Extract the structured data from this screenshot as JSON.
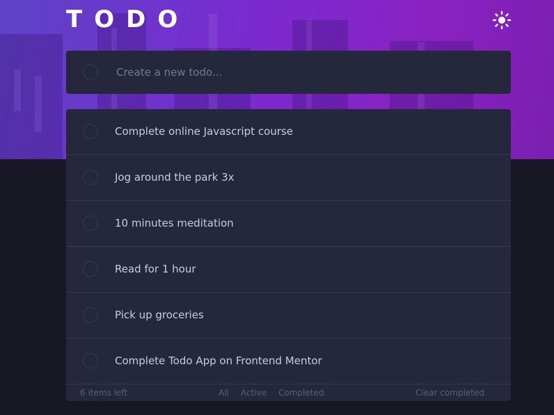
{
  "app": {
    "title": "TODO"
  },
  "theme_toggle": {
    "icon": "sun-icon"
  },
  "new_todo": {
    "placeholder": "Create a new todo..."
  },
  "todos": [
    {
      "text": "Complete online Javascript course",
      "completed": false
    },
    {
      "text": "Jog around the park 3x",
      "completed": false
    },
    {
      "text": "10 minutes meditation",
      "completed": false
    },
    {
      "text": "Read for 1 hour",
      "completed": false
    },
    {
      "text": "Pick up groceries",
      "completed": false
    },
    {
      "text": "Complete Todo App on Frontend Mentor",
      "completed": false
    }
  ],
  "footer": {
    "items_left": "6 items left",
    "filters": [
      "All",
      "Active",
      "Completed"
    ],
    "clear_completed": "Clear completed"
  },
  "colors": {
    "background": "#171823",
    "card": "#25273d",
    "text": "#c8cbe7",
    "muted": "#5b5e7e",
    "divider": "#393a4b",
    "hero_start": "#5d43c6",
    "hero_end": "#8a22c2"
  }
}
